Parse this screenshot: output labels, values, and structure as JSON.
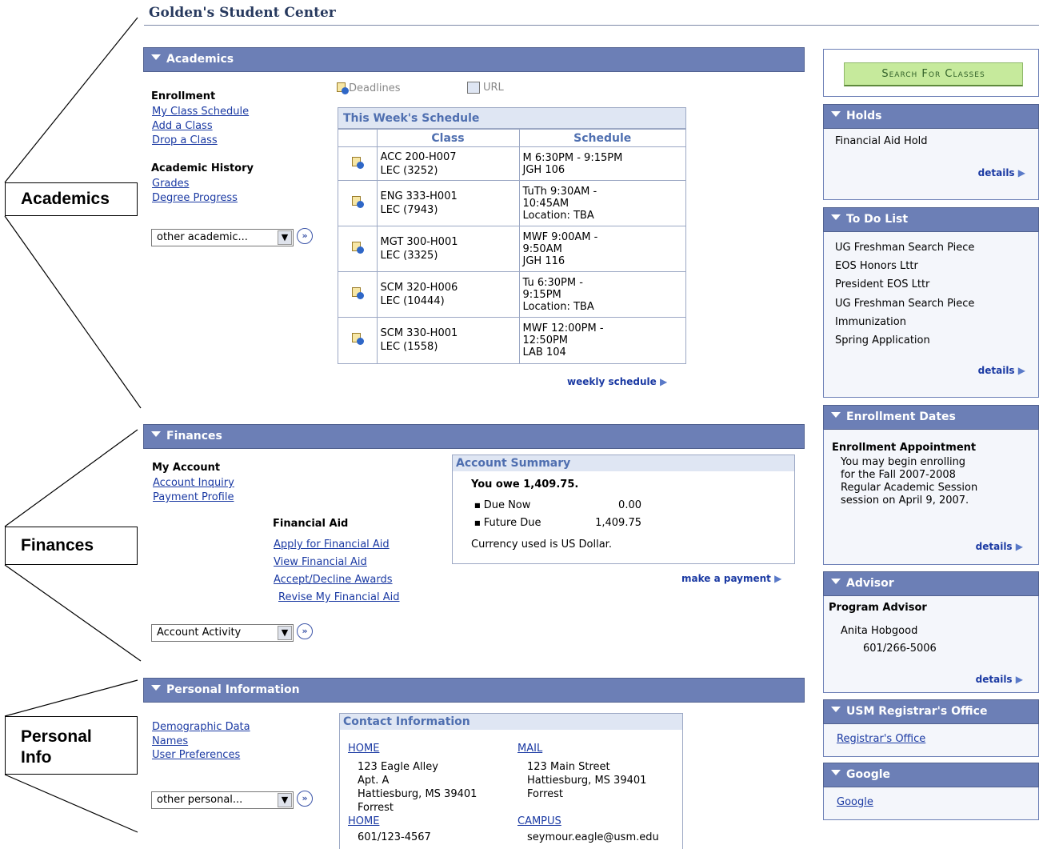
{
  "page": {
    "title": "Golden's Student Center"
  },
  "callouts": {
    "academics": "Academics",
    "finances": "Finances",
    "personal_line1": "Personal",
    "personal_line2": "Info"
  },
  "academics": {
    "header": "Academics",
    "enrollment_label": "Enrollment",
    "enrollment_links": [
      "My Class Schedule",
      "Add a Class",
      "Drop a Class"
    ],
    "history_label": "Academic History",
    "history_links": [
      "Grades",
      "Degree Progress"
    ],
    "dropdown_value": "other academic...",
    "deadlines_label": "Deadlines",
    "url_label": "URL",
    "schedule_title": "This Week's Schedule",
    "col_class": "Class",
    "col_schedule": "Schedule",
    "rows": [
      {
        "class1": "ACC 200-H007",
        "class2": "LEC (3252)",
        "sched": [
          "M 6:30PM - 9:15PM",
          "JGH 106"
        ]
      },
      {
        "class1": "ENG 333-H001",
        "class2": "LEC (7943)",
        "sched": [
          "TuTh 9:30AM -",
          "10:45AM",
          "Location:  TBA"
        ]
      },
      {
        "class1": "MGT 300-H001",
        "class2": "LEC (3325)",
        "sched": [
          "MWF 9:00AM -",
          "9:50AM",
          "JGH 116"
        ]
      },
      {
        "class1": "SCM 320-H006",
        "class2": "LEC (10444)",
        "sched": [
          "Tu 6:30PM -",
          "9:15PM",
          "Location:  TBA"
        ]
      },
      {
        "class1": "SCM 330-H001",
        "class2": "LEC (1558)",
        "sched": [
          "MWF 12:00PM -",
          "12:50PM",
          "LAB 104"
        ]
      }
    ],
    "weekly_link": "weekly schedule"
  },
  "finances": {
    "header": "Finances",
    "my_account_label": "My Account",
    "account_links": [
      "Account Inquiry",
      "Payment Profile"
    ],
    "aid_label": "Financial Aid",
    "aid_links": [
      "Apply for Financial Aid",
      "View Financial Aid",
      "Accept/Decline Awards",
      "Revise My Financial Aid"
    ],
    "summary_title": "Account Summary",
    "you_owe": "You owe 1,409.75.",
    "due_now_label": "Due Now",
    "due_now_value": "0.00",
    "future_due_label": "Future Due",
    "future_due_value": "1,409.75",
    "currency": "Currency used is US Dollar.",
    "make_payment": "make a payment",
    "dropdown_value": "Account Activity"
  },
  "personal": {
    "header": "Personal Information",
    "links": [
      "Demographic Data",
      "Names",
      "User Preferences"
    ],
    "dropdown_value": "other personal...",
    "contact_title": "Contact Information",
    "home_label": "HOME",
    "home_addr": [
      "123 Eagle Alley",
      "Apt. A",
      "Hattiesburg, MS 39401",
      "Forrest"
    ],
    "mail_label": "MAIL",
    "mail_addr": [
      "123 Main Street",
      "Hattiesburg, MS 39401",
      "Forrest"
    ],
    "home_phone_label": "HOME",
    "home_phone": "601/123-4567",
    "campus_label": "CAMPUS",
    "campus_email": "seymour.eagle@usm.edu"
  },
  "sidebar": {
    "search_button": "Search For Classes",
    "holds": {
      "header": "Holds",
      "items": [
        "Financial Aid Hold"
      ],
      "details": "details"
    },
    "todo": {
      "header": "To Do List",
      "items": [
        "UG Freshman Search Piece",
        "EOS Honors Lttr",
        "President EOS Lttr",
        "UG Freshman Search Piece",
        "Immunization",
        "Spring Application"
      ],
      "details": "details"
    },
    "enrollment_dates": {
      "header": "Enrollment Dates",
      "label": "Enrollment Appointment",
      "text": [
        "You may begin enrolling",
        "for the Fall 2007-2008",
        "Regular Academic Session",
        "session on April 9, 2007."
      ],
      "details": "details"
    },
    "advisor": {
      "header": "Advisor",
      "label": "Program Advisor",
      "name": "Anita Hobgood",
      "phone": "601/266-5006",
      "details": "details"
    },
    "registrar": {
      "header": "USM Registrar's Office",
      "link": "Registrar's Office"
    },
    "google": {
      "header": "Google",
      "link": "Google"
    }
  },
  "colors": {
    "header_bg": "#6c7fb6",
    "link": "#1b3aa3",
    "button_bg": "#c6ea9c"
  }
}
